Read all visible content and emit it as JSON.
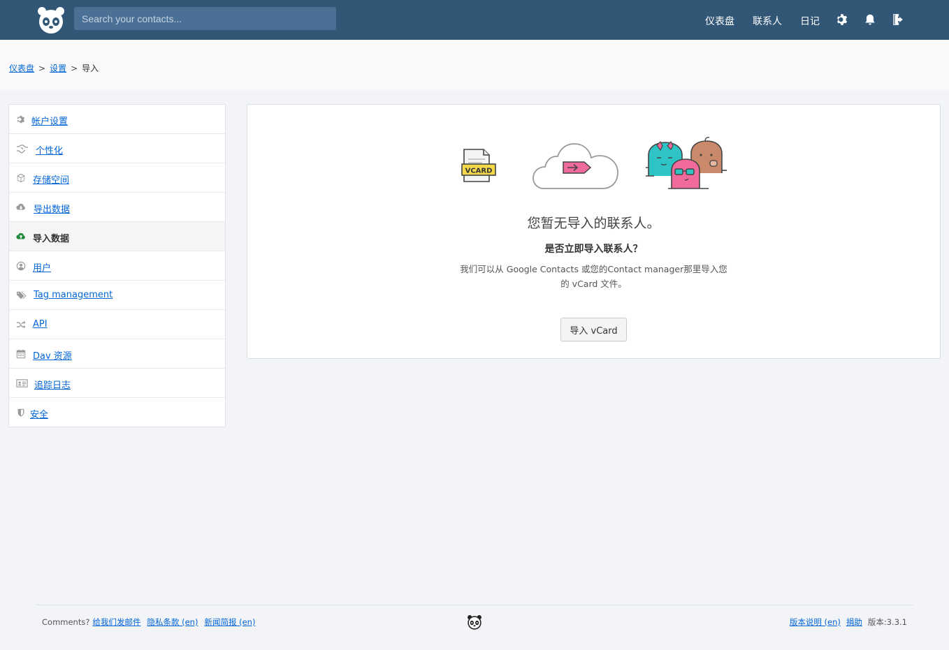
{
  "header": {
    "search_placeholder": "Search your contacts...",
    "nav": {
      "dashboard": "仪表盘",
      "contacts": "联系人",
      "journal": "日记"
    }
  },
  "breadcrumb": {
    "items": [
      "仪表盘",
      "设置",
      "导入"
    ],
    "separator": ">"
  },
  "sidebar": {
    "items": [
      {
        "label": "帐户设置",
        "icon": "gear-icon"
      },
      {
        "label": "个性化",
        "icon": "handshake-icon"
      },
      {
        "label": "存储空间",
        "icon": "box-icon"
      },
      {
        "label": "导出数据",
        "icon": "cloud-download-icon"
      },
      {
        "label": "导入数据",
        "icon": "cloud-upload-icon",
        "active": true
      },
      {
        "label": "用户",
        "icon": "user-circle-icon"
      },
      {
        "label": "Tag management",
        "icon": "tags-icon"
      },
      {
        "label": "API",
        "icon": "random-icon"
      },
      {
        "label": "Dav 资源",
        "icon": "calendar-icon"
      },
      {
        "label": "追踪日志",
        "icon": "id-card-icon"
      },
      {
        "label": "安全",
        "icon": "shield-icon"
      }
    ]
  },
  "main": {
    "illustration_label": "VCARD",
    "empty_title": "您暂无导入的联系人。",
    "empty_subtitle": "是否立即导入联系人？",
    "empty_desc_line1": "我们可以从 Google Contacts 或您的Contact manager那里导入您",
    "empty_desc_line2": "的 vCard 文件。",
    "import_button": "导入 vCard"
  },
  "footer": {
    "comments": "Comments?",
    "email_us": "给我们发邮件",
    "privacy": "隐私条款 (en)",
    "newsletter": "新闻简报 (en)",
    "release_notes": "版本说明 (en)",
    "donate": "捐助",
    "version": "版本:3.3.1"
  },
  "colors": {
    "header_bg": "#325776",
    "link": "#0366d6",
    "active_icon": "#1e8b3a"
  }
}
